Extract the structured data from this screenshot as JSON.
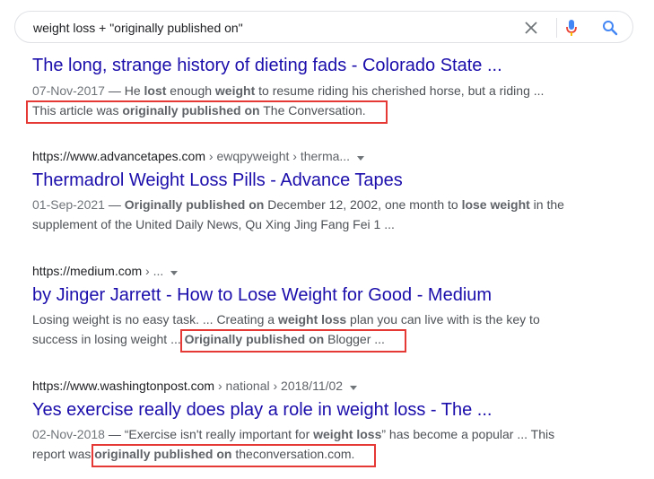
{
  "search": {
    "query": "weight loss + \"originally published on\"",
    "clear_icon": "close-icon",
    "mic_icon": "microphone-icon",
    "search_icon": "search-icon"
  },
  "results": [
    {
      "title": "The long, strange history of dieting fads - Colorado State ...",
      "date": "07-Nov-2017",
      "line1": [
        {
          "t": " — He ",
          "b": false
        },
        {
          "t": "lost",
          "b": true
        },
        {
          "t": " enough ",
          "b": false
        },
        {
          "t": "weight",
          "b": true
        },
        {
          "t": " to resume riding his cherished horse, but a riding ...",
          "b": false
        }
      ],
      "line2": [
        {
          "t": "This article was ",
          "b": false
        },
        {
          "t": "originally published on",
          "b": true
        },
        {
          "t": " The Conversation.",
          "b": false
        }
      ]
    },
    {
      "url": "https://www.advancetapes.com",
      "crumbs": " › ewqpyweight › therma...",
      "title": "Thermadrol Weight Loss Pills - Advance Tapes",
      "date": "01-Sep-2021",
      "line1": [
        {
          "t": " — ",
          "b": false
        },
        {
          "t": "Originally published on",
          "b": true
        },
        {
          "t": " December 12, 2002, one month to ",
          "b": false
        },
        {
          "t": "lose weight",
          "b": true
        },
        {
          "t": " in the",
          "b": false
        }
      ],
      "line2": [
        {
          "t": "supplement of the United Daily News, Qu Xing Jing Fang Fei 1 ...",
          "b": false
        }
      ]
    },
    {
      "url": "https://medium.com",
      "crumbs": " › ...",
      "title": "by Jinger Jarrett - How to Lose Weight for Good - Medium",
      "line1": [
        {
          "t": "Losing weight is no easy task. ... Creating a ",
          "b": false
        },
        {
          "t": "weight loss",
          "b": true
        },
        {
          "t": " plan you can live with is the key to",
          "b": false
        }
      ],
      "line2": [
        {
          "t": "success in losing weight ... ",
          "b": false
        },
        {
          "t": "Originally published on",
          "b": true
        },
        {
          "t": " Blogger ...",
          "b": false
        }
      ]
    },
    {
      "url": "https://www.washingtonpost.com",
      "crumbs": " › national › 2018/11/02",
      "title": "Yes exercise really does play a role in weight loss - The ...",
      "date": "02-Nov-2018",
      "line1": [
        {
          "t": " — “Exercise isn't really important for ",
          "b": false
        },
        {
          "t": "weight loss",
          "b": true
        },
        {
          "t": "” has become a popular ... This",
          "b": false
        }
      ],
      "line2": [
        {
          "t": "report was ",
          "b": false
        },
        {
          "t": "originally published on",
          "b": true
        },
        {
          "t": " theconversation.com.",
          "b": false
        }
      ]
    }
  ],
  "colors": {
    "title_link": "#1a0dab",
    "highlight_box": "#e53935",
    "mic_blue": "#4285f4",
    "mic_red": "#ea4335"
  }
}
